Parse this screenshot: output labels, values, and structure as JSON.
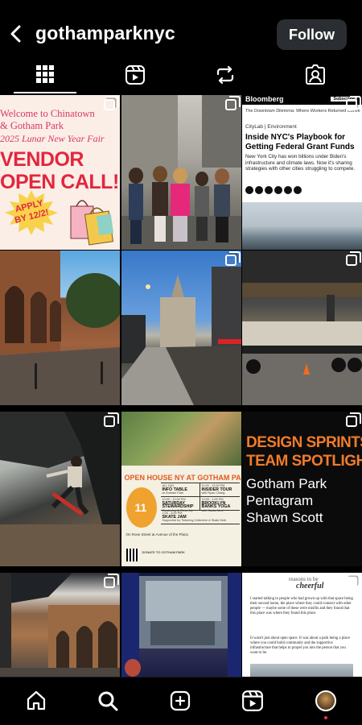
{
  "header": {
    "username": "gothamparknyc",
    "follow_label": "Follow"
  },
  "tabs": [
    "posts",
    "reels",
    "reposts",
    "tagged"
  ],
  "posts": {
    "vendor": {
      "line1": "Welcome to Chinatown",
      "line2": "& Gotham Park",
      "line3": "2025 Lunar New Year Fair",
      "big1": "VENDOR",
      "big2": "OPEN CALL!",
      "apply": "APPLY BY 12/2!"
    },
    "bloomberg": {
      "brand": "Bloomberg",
      "subscribe": "Subscribe",
      "nav": "The Downtown Dilemma:  Where Workers Returned   Conve",
      "kicker": "CityLab | Environment",
      "headline": "Inside NYC's Playbook for Getting Federal Grant Funds",
      "body": "New York City has won billions under Biden's infrastructure and climate laws. Now it's sharing strategies with other cities struggling to compete."
    },
    "openhouse": {
      "title": "OPEN HOUSE NY AT GOTHAM PARK",
      "date": "11",
      "location": "On Rose Street at Avenue of the Plaza",
      "donate": "DONATE TO GOTHAM PARK",
      "schedule": [
        {
          "time": "ALL DAY",
          "label": "INFO TABLE",
          "sub": "at Gotham Park"
        },
        {
          "time": "11:00 - 12:00 PM",
          "label": "INSIDER TOUR",
          "sub": "with Ryan Chang"
        },
        {
          "time": "10:00 - 12:00 PM",
          "label": "SATURDAY STEWARDSHIP",
          "sub": "Gardening & Clean Up"
        },
        {
          "time": "12:00 - 1:00 PM",
          "label": "BROOKLYN BANKS YOGA",
          "sub": "with Studio Med"
        },
        {
          "time": "1:00 - 3:00 PM",
          "label": "SKATE JAM",
          "sub": "Supported by Tinkering Collective & Skate Mob"
        }
      ]
    },
    "design": {
      "h1": "DESIGN SPRINTS",
      "h2": "TEAM SPOTLIGHT",
      "n1": "Gotham Park",
      "n2": "Pentagram",
      "n3": "Shawn Scott"
    },
    "cheerful": {
      "reasons": "reasons",
      "tobe": "to be",
      "word": "cheerful",
      "p1": "I started talking to people who had grown up with that space being their second home, the place where they could connect with other people — maybe some of these were misfits and they found that this place was where they found this place.",
      "p2": "It wasn't just about open space. It was about a park being a place where you could build community and the supportive infrastructure that helps to propel you into the person that you want to be."
    }
  },
  "colors": {
    "accent_red": "#e3263f",
    "design_orange": "#f17b2a",
    "follow_bg": "#2a2d31",
    "notif_dot": "#ff3040"
  },
  "bottom_nav": [
    "home-icon",
    "search-icon",
    "create-icon",
    "reels-icon",
    "profile-avatar"
  ]
}
